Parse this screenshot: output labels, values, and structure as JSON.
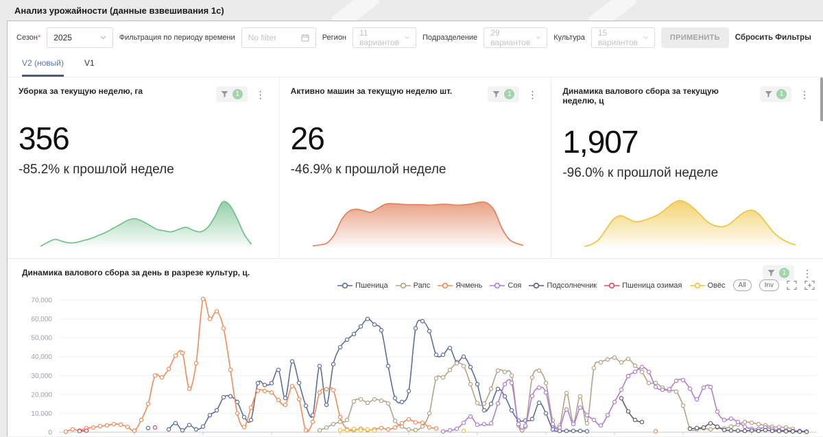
{
  "page": {
    "title": "Анализ урожайности (данные взвешивания 1с)"
  },
  "filters": {
    "season_label": "Сезон",
    "required_mark": "*",
    "season_value": "2025",
    "period_label": "Фильтрация по периоду времени",
    "period_placeholder": "No filter",
    "region_label": "Регион",
    "region_placeholder": "11 вариантов",
    "division_label": "Подразделение",
    "division_placeholder": "29 вариантов",
    "culture_label": "Культура",
    "culture_placeholder": "15 вариантов",
    "apply_label": "ПРИМЕНИТЬ",
    "reset_label": "Сбросить Фильтры"
  },
  "tabs": {
    "v2": "V2 (новый)",
    "v1": "V1"
  },
  "kpi_cards": [
    {
      "title": "Уборка за текущую неделю, га",
      "value": "356",
      "delta": "-85.2% к прошлой неделе",
      "filter_badge": "1"
    },
    {
      "title": "Активно машин за текущую неделю шт.",
      "value": "26",
      "delta": "-46.9% к прошлой неделе",
      "filter_badge": "1"
    },
    {
      "title": "Динамика валового сбора за текущую неделю, ц",
      "value": "1,907",
      "delta": "-96.0% к прошлой неделе",
      "filter_badge": "1"
    }
  ],
  "main_chart": {
    "title": "Динамика валового сбора за день в разрезе культур, ц.",
    "filter_badge": "1",
    "legend_buttons": {
      "all": "All",
      "inv": "Inv"
    }
  },
  "chart_data": [
    {
      "type": "line",
      "title": "Динамика валового сбора за день в разрезе культур, ц.",
      "ylim": [
        0,
        70000
      ],
      "ytick_step": 10000,
      "ytick_labels": [
        "0",
        "10,000",
        "20,000",
        "30,000",
        "40,000",
        "50,000",
        "60,000",
        "70,000"
      ],
      "x_axis_labels_visible": false,
      "x_unit": "day_index",
      "grid": true,
      "legend_position": "top-right",
      "series": [
        {
          "name": "Пшеница",
          "color": "#5e6b9d",
          "segments": [
            {
              "start": 12,
              "values": [
                2200
              ]
            },
            {
              "start": 15,
              "values": [
                1500,
                4800,
                1000,
                3800,
                1500,
                3000,
                9000,
                11600,
                18500,
                19000,
                16000,
                8000,
                6500,
                26000,
                25000,
                26000,
                33000,
                18100,
                37500,
                26100,
                14000,
                9000,
                35000,
                14500,
                36000,
                45000,
                49000,
                52000,
                56000,
                60000,
                57000,
                54000,
                35000,
                18000,
                16000,
                21800,
                55000,
                58800,
                53500,
                41000,
                41000,
                44600,
                37000,
                40000,
                34500,
                25400,
                11600,
                15000,
                22900,
                19000,
                11600,
                6200,
                6200,
                7000,
                15600,
                10000,
                1500,
                700,
                700,
                700,
                700,
                500
              ]
            }
          ]
        },
        {
          "name": "Рапс",
          "color": "#b3a284",
          "segments": [
            {
              "start": 37,
              "values": [
                1000,
                2500,
                4300,
                5500,
                6500,
                16300,
                17400,
                15600,
                17400,
                16700,
                15200,
                6000,
                3000,
                1500,
                1200,
                3000,
                10000,
                28500,
                29000,
                33000,
                36500,
                35000,
                25400,
                15400,
                15200,
                23000,
                32600,
                31900,
                30000,
                3600,
                2900,
                29000,
                32600,
                26000,
                6200,
                3500,
                20700,
                5000,
                19000,
                4700,
                34000,
                37000,
                38500,
                39500,
                37000,
                38800,
                35200,
                31900,
                26100,
                26100,
                23600,
                22000,
                21500,
                14100,
                2000,
                1500,
                2000,
                1500,
                2500,
                2000,
                3000,
                4000,
                5400,
                5000,
                4300,
                3600,
                2900,
                2700,
                2500,
                1800
              ]
            }
          ]
        },
        {
          "name": "Ячмень",
          "color": "#f28a58",
          "segments": [
            {
              "start": 0,
              "values": [
                300,
                1500,
                900,
                2100,
                2500,
                3200,
                3600,
                4300,
                4000,
                2800,
                800,
                6500,
                15000,
                30000,
                29000,
                33500,
                40500,
                42000,
                23000,
                36500,
                70500,
                60000,
                64000,
                55000,
                33000,
                10000,
                2700,
                13000,
                22000,
                21800,
                21000,
                17000,
                14500,
                24400,
                17500,
                1000,
                5500,
                21000,
                22800,
                22300,
                8000,
                1500,
                1100,
                1800,
                1100,
                1500,
                2200,
                1500,
                2500,
                4800,
                6800,
                5200,
                5000,
                2600,
                2000
              ]
            },
            {
              "start": 86,
              "values": [
                500
              ]
            }
          ]
        },
        {
          "name": "Соя",
          "color": "#b07cd3",
          "segments": [
            {
              "start": 55,
              "values": [
                400,
                1000,
                1800,
                5000,
                8300,
                4000,
                4300,
                4700,
                15200,
                25400,
                26100,
                4300,
                3500,
                19200,
                23600,
                21000,
                4300,
                2500,
                12000,
                4300,
                13000,
                9000,
                6500,
                3600,
                9000,
                16000,
                22500,
                29700,
                32000,
                34500,
                31900,
                24000,
                22500,
                22800,
                27200,
                27600,
                23000,
                17400,
                23600,
                23900,
                10900,
                6500,
                7200,
                5400,
                2900,
                1800,
                1800,
                2500,
                1800,
                1100,
                900,
                700,
                700,
                400
              ]
            }
          ]
        },
        {
          "name": "Подсолнечник",
          "color": "#5a5f6e",
          "segments": [
            {
              "start": 81,
              "values": [
                18000,
                11000,
                6500,
                5400
              ]
            },
            {
              "start": 91,
              "values": [
                1800,
                2200,
                2500,
                4700,
                2900,
                1200,
                900,
                800,
                700,
                900,
                700,
                1100,
                700,
                600,
                500,
                400,
                300,
                200
              ]
            }
          ]
        },
        {
          "name": "Пшеница озимая",
          "color": "#e0485f",
          "segments": [
            {
              "start": 2,
              "values": [
                600,
                800
              ]
            },
            {
              "start": 13,
              "values": [
                2500
              ]
            }
          ]
        },
        {
          "name": "Овёс",
          "color": "#f1c437",
          "segments": [
            {
              "start": 40,
              "values": [
                1100,
                1100,
                1800,
                1100,
                1500,
                800
              ]
            },
            {
              "start": 58,
              "values": [
                700
              ]
            }
          ]
        }
      ]
    },
    {
      "type": "area",
      "title": "Уборка за текущую неделю, га",
      "color": "#6fbf8a",
      "values_pct": [
        2,
        10,
        16,
        12,
        9,
        10,
        14,
        18,
        24,
        30,
        38,
        46,
        54,
        57,
        52,
        44,
        36,
        33,
        31,
        36,
        40,
        34,
        31,
        40,
        62,
        90,
        84,
        58,
        26,
        6
      ]
    },
    {
      "type": "area",
      "title": "Активно машин за текущую неделю шт.",
      "color": "#e2815b",
      "values_pct": [
        3,
        5,
        9,
        26,
        56,
        72,
        76,
        73,
        70,
        78,
        86,
        87,
        86,
        85,
        85,
        85,
        84,
        85,
        86,
        85,
        84,
        85,
        87,
        90,
        88,
        72,
        38,
        16,
        8,
        4
      ]
    },
    {
      "type": "area",
      "title": "Динамика валового сбора за текущую неделю, ц",
      "color": "#eec33f",
      "values_pct": [
        2,
        6,
        16,
        36,
        56,
        63,
        57,
        51,
        53,
        58,
        64,
        74,
        86,
        93,
        89,
        78,
        64,
        50,
        43,
        41,
        47,
        59,
        70,
        74,
        66,
        48,
        30,
        18,
        10,
        5
      ]
    }
  ]
}
